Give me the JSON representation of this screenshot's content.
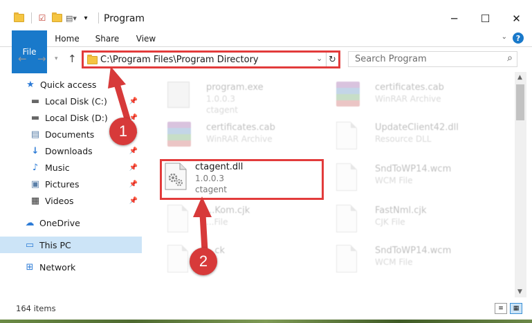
{
  "window": {
    "title": "Program",
    "controls": [
      "minimize",
      "maximize",
      "close"
    ]
  },
  "ribbon": {
    "tabs": [
      "File",
      "Home",
      "Share",
      "View"
    ],
    "help": "?"
  },
  "address": {
    "path": "C:\\Program Files\\Program Directory",
    "search_placeholder": "Search Program"
  },
  "sidebar": {
    "items": [
      {
        "label": "Quick access",
        "icon": "star-icon",
        "pinned": false
      },
      {
        "label": "Local Disk (C:)",
        "icon": "drive-icon",
        "pinned": true
      },
      {
        "label": "Local Disk (D:)",
        "icon": "drive-icon",
        "pinned": true
      },
      {
        "label": "Documents",
        "icon": "documents-icon",
        "pinned": true
      },
      {
        "label": "Downloads",
        "icon": "download-icon",
        "pinned": true
      },
      {
        "label": "Music",
        "icon": "music-icon",
        "pinned": true
      },
      {
        "label": "Pictures",
        "icon": "pictures-icon",
        "pinned": true
      },
      {
        "label": "Videos",
        "icon": "videos-icon",
        "pinned": true
      },
      {
        "label": "OneDrive",
        "icon": "cloud-icon",
        "pinned": false
      },
      {
        "label": "This PC",
        "icon": "computer-icon",
        "pinned": false,
        "selected": true
      },
      {
        "label": "Network",
        "icon": "network-icon",
        "pinned": false
      }
    ]
  },
  "files": [
    {
      "name": "program.exe",
      "line2": "1.0.0.3",
      "line3": "ctagent",
      "icon": "exe-icon"
    },
    {
      "name": "certificates.cab",
      "line2": "WinRAR Archive",
      "line3": "",
      "icon": "winrar-icon"
    },
    {
      "name": "certificates.cab",
      "line2": "WinRAR Archive",
      "line3": "",
      "icon": "winrar-icon"
    },
    {
      "name": "UpdateClient42.dll",
      "line2": "Resource DLL",
      "line3": "",
      "icon": "dll-icon"
    },
    {
      "name": "ctagent.dll",
      "line2": "1.0.0.3",
      "line3": "ctagent",
      "icon": "dll-gear-icon",
      "highlighted": true
    },
    {
      "name": "SndToWP14.wcm",
      "line2": "WCM File",
      "line3": "",
      "icon": "file-icon"
    },
    {
      "name": "...Kom.cjk",
      "line2": "...File",
      "line3": "",
      "icon": "file-icon"
    },
    {
      "name": "FastNml.cjk",
      "line2": "CJK File",
      "line3": "",
      "icon": "file-icon"
    },
    {
      "name": "...ck",
      "line2": "",
      "line3": "",
      "icon": "file-icon"
    },
    {
      "name": "SndToWP14.wcm",
      "line2": "WCM File",
      "line3": "",
      "icon": "file-icon"
    }
  ],
  "status": {
    "item_count": "164 items"
  },
  "annotations": {
    "step1": "1",
    "step2": "2",
    "color": "#d73a3a"
  }
}
